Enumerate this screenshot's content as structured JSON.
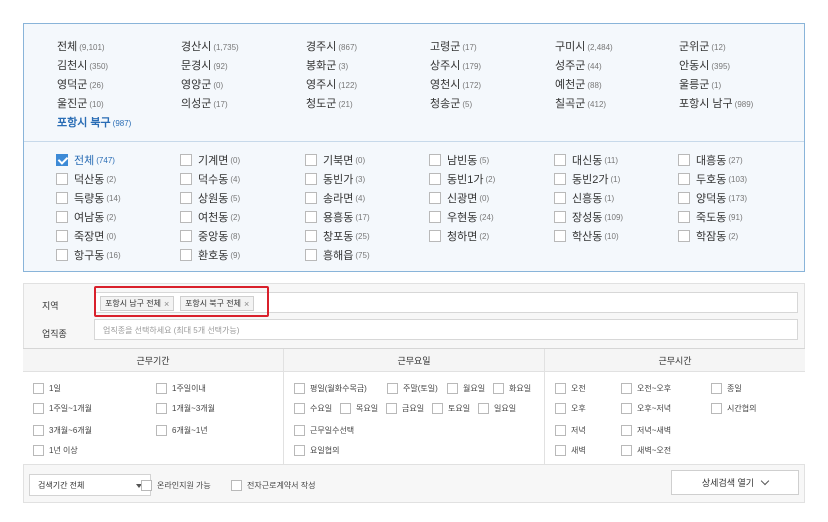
{
  "cities": [
    {
      "name": "전체",
      "count": "(9,101)"
    },
    {
      "name": "경산시",
      "count": "(1,735)"
    },
    {
      "name": "경주시",
      "count": "(867)"
    },
    {
      "name": "고령군",
      "count": "(17)"
    },
    {
      "name": "구미시",
      "count": "(2,484)"
    },
    {
      "name": "군위군",
      "count": "(12)"
    },
    {
      "name": "김천시",
      "count": "(350)"
    },
    {
      "name": "문경시",
      "count": "(92)"
    },
    {
      "name": "봉화군",
      "count": "(3)"
    },
    {
      "name": "상주시",
      "count": "(179)"
    },
    {
      "name": "성주군",
      "count": "(44)"
    },
    {
      "name": "안동시",
      "count": "(395)"
    },
    {
      "name": "영덕군",
      "count": "(26)"
    },
    {
      "name": "영양군",
      "count": "(0)"
    },
    {
      "name": "영주시",
      "count": "(122)"
    },
    {
      "name": "영천시",
      "count": "(172)"
    },
    {
      "name": "예천군",
      "count": "(88)"
    },
    {
      "name": "울릉군",
      "count": "(1)"
    },
    {
      "name": "울진군",
      "count": "(10)"
    },
    {
      "name": "의성군",
      "count": "(17)"
    },
    {
      "name": "청도군",
      "count": "(21)"
    },
    {
      "name": "청송군",
      "count": "(5)"
    },
    {
      "name": "칠곡군",
      "count": "(412)"
    },
    {
      "name": "포항시 남구",
      "count": "(989)"
    },
    {
      "name": "포항시 북구",
      "count": "(987)",
      "active": true
    }
  ],
  "dongs": [
    {
      "name": "전체",
      "count": "(747)",
      "checked": true
    },
    {
      "name": "기계면",
      "count": "(0)"
    },
    {
      "name": "기북면",
      "count": "(0)"
    },
    {
      "name": "남빈동",
      "count": "(5)"
    },
    {
      "name": "대신동",
      "count": "(11)"
    },
    {
      "name": "대흥동",
      "count": "(27)"
    },
    {
      "name": "덕산동",
      "count": "(2)"
    },
    {
      "name": "덕수동",
      "count": "(4)"
    },
    {
      "name": "동빈가",
      "count": "(3)"
    },
    {
      "name": "동빈1가",
      "count": "(2)"
    },
    {
      "name": "동빈2가",
      "count": "(1)"
    },
    {
      "name": "두호동",
      "count": "(103)"
    },
    {
      "name": "득량동",
      "count": "(14)"
    },
    {
      "name": "상원동",
      "count": "(5)"
    },
    {
      "name": "송라면",
      "count": "(4)"
    },
    {
      "name": "신광면",
      "count": "(0)"
    },
    {
      "name": "신흥동",
      "count": "(1)"
    },
    {
      "name": "양덕동",
      "count": "(173)"
    },
    {
      "name": "여남동",
      "count": "(2)"
    },
    {
      "name": "여천동",
      "count": "(2)"
    },
    {
      "name": "용흥동",
      "count": "(17)"
    },
    {
      "name": "우현동",
      "count": "(24)"
    },
    {
      "name": "장성동",
      "count": "(109)"
    },
    {
      "name": "죽도동",
      "count": "(91)"
    },
    {
      "name": "죽장면",
      "count": "(0)"
    },
    {
      "name": "중앙동",
      "count": "(8)"
    },
    {
      "name": "창포동",
      "count": "(25)"
    },
    {
      "name": "청하면",
      "count": "(2)"
    },
    {
      "name": "학산동",
      "count": "(10)"
    },
    {
      "name": "학잠동",
      "count": "(2)"
    },
    {
      "name": "항구동",
      "count": "(16)"
    },
    {
      "name": "환호동",
      "count": "(9)"
    },
    {
      "name": "흥해읍",
      "count": "(75)"
    }
  ],
  "filter": {
    "region_label": "지역",
    "job_label": "업직종",
    "chips": [
      "포항시 남구 전체",
      "포항시 북구 전체"
    ],
    "chip_remove": "×",
    "job_placeholder": "업직종을 선택하세요 (최대 5개 선택가능)"
  },
  "conditions": {
    "period_header": "근무기간",
    "days_header": "근무요일",
    "time_header": "근무시간",
    "period": [
      "1일",
      "1주일이내",
      "1주일~1개월",
      "1개월~3개월",
      "3개월~6개월",
      "6개월~1년",
      "1년 이상"
    ],
    "days": [
      "평일(월화수목금)",
      "주말(토일)",
      "월요일",
      "화요일",
      "수요일",
      "목요일",
      "금요일",
      "토요일",
      "일요일",
      "근무일수선택",
      "요일협의"
    ],
    "time": [
      "오전",
      "오전~오후",
      "종일",
      "오후",
      "오후~저녁",
      "시간협의",
      "저녁",
      "저녁~새벽",
      "새벽",
      "새벽~오전"
    ]
  },
  "bottom": {
    "period_select": "검색기간 전체",
    "online": "온라인지원 가능",
    "contract": "전자근로계약서 작성",
    "advanced": "상세검색 열기"
  }
}
